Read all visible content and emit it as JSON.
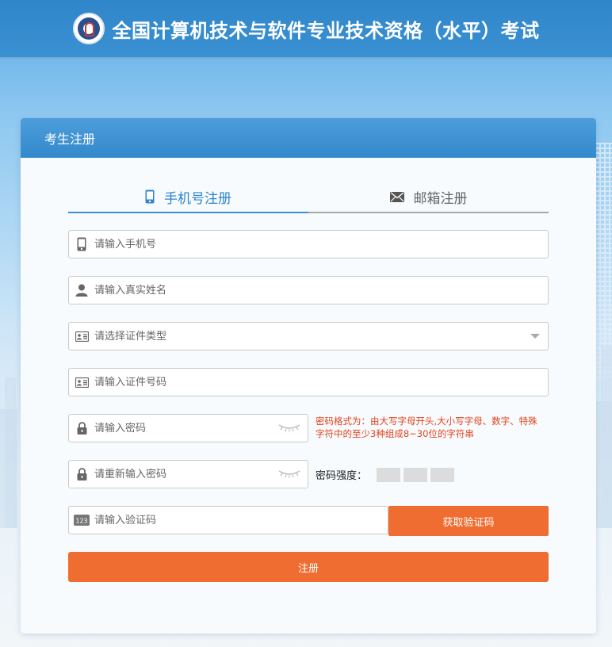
{
  "header": {
    "title": "全国计算机技术与软件专业技术资格（水平）考试",
    "logo_icon": "exam-authority-logo-icon"
  },
  "panel": {
    "title": "考生注册"
  },
  "tabs": [
    {
      "label": "手机号注册",
      "icon": "mobile-phone-icon",
      "active": true
    },
    {
      "label": "邮箱注册",
      "icon": "envelope-icon",
      "active": false
    }
  ],
  "form": {
    "phone": {
      "placeholder": "请输入手机号",
      "value": ""
    },
    "name": {
      "placeholder": "请输入真实姓名",
      "value": ""
    },
    "id_type": {
      "placeholder": "请选择证件类型",
      "value": ""
    },
    "id_number": {
      "placeholder": "请输入证件号码",
      "value": ""
    },
    "password": {
      "placeholder": "请输入密码",
      "value": ""
    },
    "password_confirm": {
      "placeholder": "请重新输入密码",
      "value": ""
    },
    "verify_code": {
      "placeholder": "请输入验证码",
      "value": ""
    }
  },
  "password_hint": "密码格式为：由大写字母开头,大小写字母、数字、特殊字符中的至少3种组成8~30位的字符串",
  "strength": {
    "label": "密码强度：",
    "level": 0,
    "segments": 3
  },
  "buttons": {
    "get_code": "获取验证码",
    "register": "注册"
  },
  "colors": {
    "header": "#3a90d1",
    "accent": "#f06d32",
    "active_tab": "#2f84cf",
    "hint": "#e2431d"
  }
}
